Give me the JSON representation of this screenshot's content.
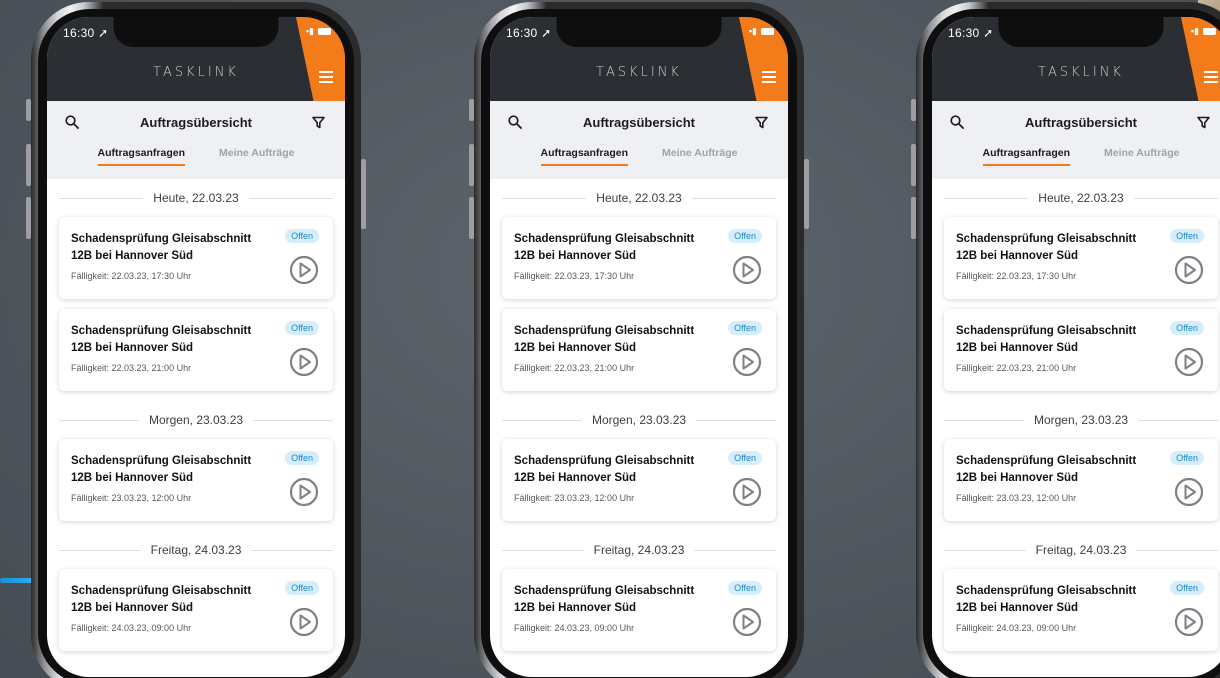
{
  "theme": {
    "accent": "#f47b1a",
    "header_bg": "#2b2e33",
    "badge_bg": "#d6eefb",
    "badge_text": "#1e86c8"
  },
  "status": {
    "time": "16:30 ➚"
  },
  "app": {
    "brand": "TASKLINK",
    "title": "Auftragsübersicht",
    "tabs": [
      "Auftragsanfragen",
      "Meine Aufträge"
    ],
    "active_tab": 0
  },
  "icons": [
    "search-icon",
    "filter-icon",
    "menu-icon",
    "play-icon"
  ],
  "groups": [
    {
      "date": "Heute, 22.03.23",
      "tasks": [
        {
          "title": "Schadensprüfung Gleisabschnitt 12B bei Hannover Süd",
          "due": "Fälligkeit: 22.03.23, 17:30 Uhr",
          "status": "Offen"
        },
        {
          "title": "Schadensprüfung Gleisabschnitt 12B bei Hannover Süd",
          "due": "Fälligkeit: 22.03.23, 21:00 Uhr",
          "status": "Offen"
        }
      ]
    },
    {
      "date": "Morgen, 23.03.23",
      "tasks": [
        {
          "title": "Schadensprüfung Gleisabschnitt 12B bei Hannover Süd",
          "due": "Fälligkeit: 23.03.23, 12:00 Uhr",
          "status": "Offen"
        }
      ]
    },
    {
      "date": "Freitag, 24.03.23",
      "tasks": [
        {
          "title": "Schadensprüfung Gleisabschnitt 12B bei Hannover Süd",
          "due": "Fälligkeit: 24.03.23, 09:00 Uhr",
          "status": "Offen"
        }
      ]
    }
  ]
}
